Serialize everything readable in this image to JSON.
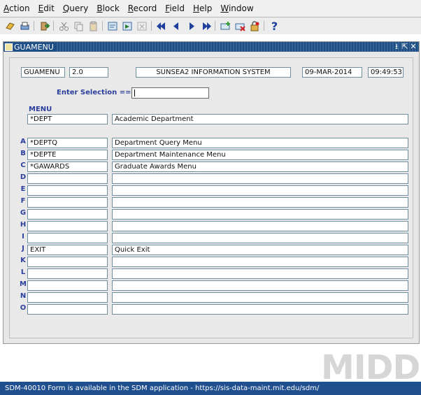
{
  "menu": {
    "items": [
      {
        "label_u": "A",
        "label_rest": "ction"
      },
      {
        "label_u": "E",
        "label_rest": "dit"
      },
      {
        "label_u": "Q",
        "label_rest": "uery"
      },
      {
        "label_u": "B",
        "label_rest": "lock"
      },
      {
        "label_u": "R",
        "label_rest": "ecord"
      },
      {
        "label_u": "F",
        "label_rest": "ield"
      },
      {
        "label_u": "H",
        "label_rest": "elp"
      },
      {
        "label_u": "W",
        "label_rest": "indow"
      }
    ]
  },
  "toolbar": {
    "icons": [
      "save-icon",
      "print-icon",
      "exit-icon",
      "cut-icon",
      "copy-icon",
      "paste-icon",
      "enter-query-icon",
      "execute-query-icon",
      "cancel-query-icon",
      "first-record-icon",
      "previous-record-icon",
      "next-record-icon",
      "last-record-icon",
      "insert-record-icon",
      "delete-record-icon",
      "lock-record-icon",
      "help-icon"
    ],
    "help_glyph": "?"
  },
  "window": {
    "title": "GUAMENU",
    "controls": [
      "⭳",
      "⇱",
      "✕"
    ]
  },
  "header": {
    "form_name": "GUAMENU",
    "version": "2.0",
    "system": "SUNSEA2 INFORMATION SYSTEM",
    "date": "09-MAR-2014",
    "time": "09:49:53"
  },
  "selection": {
    "label": "Enter Selection ==>",
    "value": ""
  },
  "menu_section": {
    "label": "MENU",
    "code": "*DEPT",
    "description": "Academic Department"
  },
  "rows": [
    {
      "letter": "A",
      "code": "*DEPTQ",
      "description": "Department Query Menu"
    },
    {
      "letter": "B",
      "code": "*DEPTE",
      "description": "Department Maintenance Menu"
    },
    {
      "letter": "C",
      "code": "*GAWARDS",
      "description": "Graduate Awards Menu"
    },
    {
      "letter": "D",
      "code": "",
      "description": ""
    },
    {
      "letter": "E",
      "code": "",
      "description": ""
    },
    {
      "letter": "F",
      "code": "",
      "description": ""
    },
    {
      "letter": "G",
      "code": "",
      "description": ""
    },
    {
      "letter": "H",
      "code": "",
      "description": ""
    },
    {
      "letter": "I",
      "code": "",
      "description": ""
    },
    {
      "letter": "J",
      "code": "EXIT",
      "description": "Quick Exit"
    },
    {
      "letter": "K",
      "code": "",
      "description": ""
    },
    {
      "letter": "L",
      "code": "",
      "description": ""
    },
    {
      "letter": "M",
      "code": "",
      "description": ""
    },
    {
      "letter": "N",
      "code": "",
      "description": ""
    },
    {
      "letter": "O",
      "code": "",
      "description": ""
    }
  ],
  "watermark": "MIDD",
  "status": "SDM-40010 Form is available in the SDM application - https://sis-data-maint.mit.edu/sdm/",
  "colors": {
    "accent": "#1f4f8f",
    "label_blue": "#2b3f9e"
  }
}
